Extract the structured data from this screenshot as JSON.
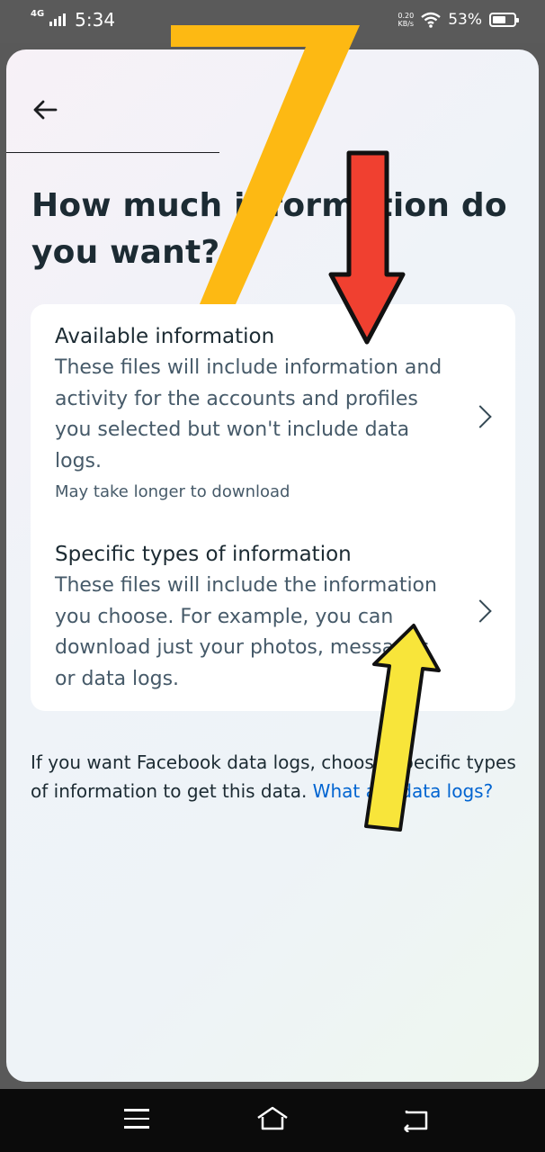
{
  "status": {
    "network": "4G",
    "time": "5:34",
    "speed_value": "0.20",
    "speed_unit": "KB/s",
    "battery": "53%"
  },
  "header": {
    "back_icon": "arrow-left-icon",
    "title": "How much information do you want?"
  },
  "options": [
    {
      "title": "Available information",
      "description": "These files will include information and activity for the accounts and profiles you selected but won't include data logs.",
      "note": "May take longer to download"
    },
    {
      "title": "Specific types of information",
      "description": "These files will include the information you choose. For example, you can download just your photos, messages or data logs."
    }
  ],
  "footer": {
    "text": "If you want Facebook data logs, choose Specific types of information to get this data. ",
    "link": "What are data logs?"
  },
  "annotations": {
    "step_number": "7",
    "colors": {
      "number": "#FDB913",
      "red_arrow": "#F04030",
      "yellow_arrow": "#F8E53A"
    }
  },
  "navbar": {
    "icons": [
      "menu-icon",
      "home-icon",
      "back-icon"
    ]
  }
}
